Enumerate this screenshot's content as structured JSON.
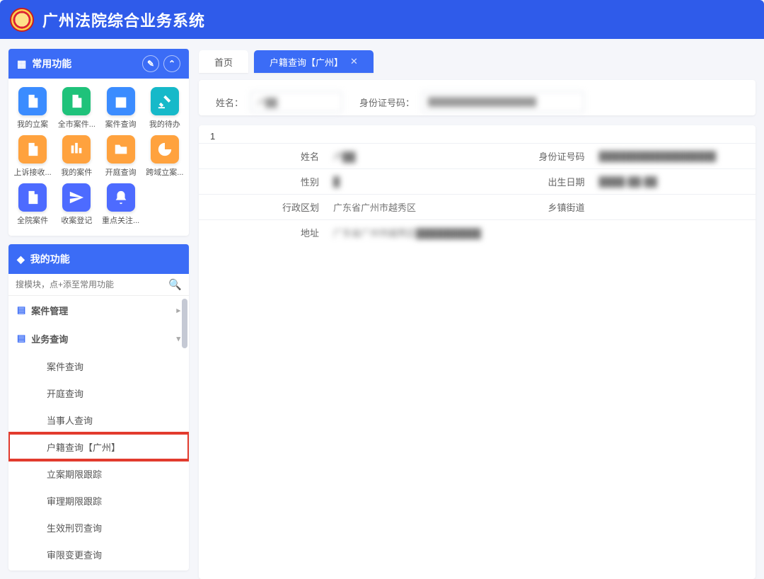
{
  "header": {
    "title": "广州法院综合业务系统"
  },
  "sidebar": {
    "fav_title": "常用功能",
    "fav_items": [
      {
        "label": "我的立案",
        "color": "c-blue",
        "icon": "file"
      },
      {
        "label": "全市案件...",
        "color": "c-green",
        "icon": "file"
      },
      {
        "label": "案件查询",
        "color": "c-blue",
        "icon": "building"
      },
      {
        "label": "我的待办",
        "color": "c-teal",
        "icon": "gavel"
      },
      {
        "label": "上诉接收...",
        "color": "c-orange",
        "icon": "file"
      },
      {
        "label": "我的案件",
        "color": "c-orange",
        "icon": "bars"
      },
      {
        "label": "开庭查询",
        "color": "c-orange",
        "icon": "folder"
      },
      {
        "label": "跨域立案...",
        "color": "c-orange",
        "icon": "pie"
      },
      {
        "label": "全院案件",
        "color": "c-indigo",
        "icon": "file"
      },
      {
        "label": "收案登记",
        "color": "c-indigo",
        "icon": "send"
      },
      {
        "label": "重点关注...",
        "color": "c-indigo",
        "icon": "bell"
      }
    ],
    "my_title": "我的功能",
    "search_placeholder": "搜模块，点+添至常用功能",
    "groups": [
      {
        "label": "案件管理",
        "expanded": false
      },
      {
        "label": "业务查询",
        "expanded": true,
        "items": [
          {
            "label": "案件查询"
          },
          {
            "label": "开庭查询"
          },
          {
            "label": "当事人查询"
          },
          {
            "label": "户籍查询【广州】",
            "highlight": true
          },
          {
            "label": "立案期限跟踪"
          },
          {
            "label": "审理期限跟踪"
          },
          {
            "label": "生效刑罚查询"
          },
          {
            "label": "审限变更查询"
          }
        ]
      }
    ]
  },
  "tabs": [
    {
      "label": "首页",
      "active": false,
      "closable": false
    },
    {
      "label": "户籍查询【广州】",
      "active": true,
      "closable": true
    }
  ],
  "search": {
    "name_label": "姓名：",
    "name_value": "卢██",
    "id_label": "身份证号码：",
    "id_value": "██████████████████"
  },
  "result": {
    "index": "1",
    "rows": [
      {
        "k": "姓名",
        "v": "卢██",
        "k2": "身份证号码",
        "v2": "██████████████████"
      },
      {
        "k": "性别",
        "v": "█",
        "k2": "出生日期",
        "v2": "████-██-██"
      },
      {
        "k": "行政区划",
        "v": "广东省广州市越秀区",
        "k2": "乡镇街道",
        "v2": ""
      },
      {
        "k": "地址",
        "v": "广东省广州市越秀区██████████",
        "k2": "",
        "v2": ""
      }
    ]
  }
}
